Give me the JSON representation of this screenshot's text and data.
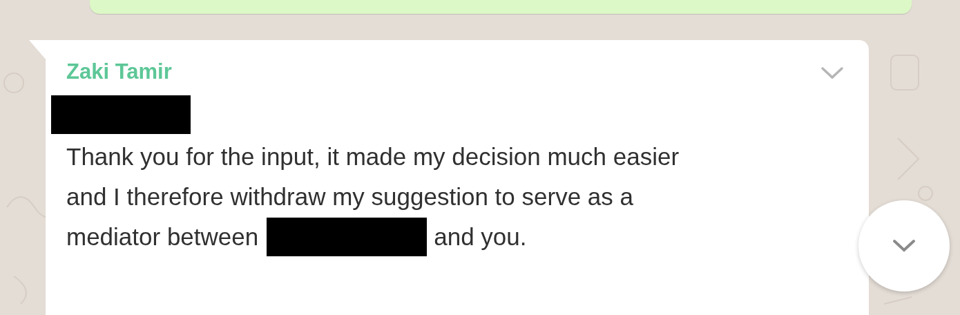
{
  "message": {
    "sender": "Zaki Tamir",
    "lines": [
      "Thank you for the input, it made my decision much easier",
      "and I therefore withdraw my suggestion to serve as a"
    ],
    "last_line_before": "mediator between",
    "last_line_after": "and you."
  }
}
